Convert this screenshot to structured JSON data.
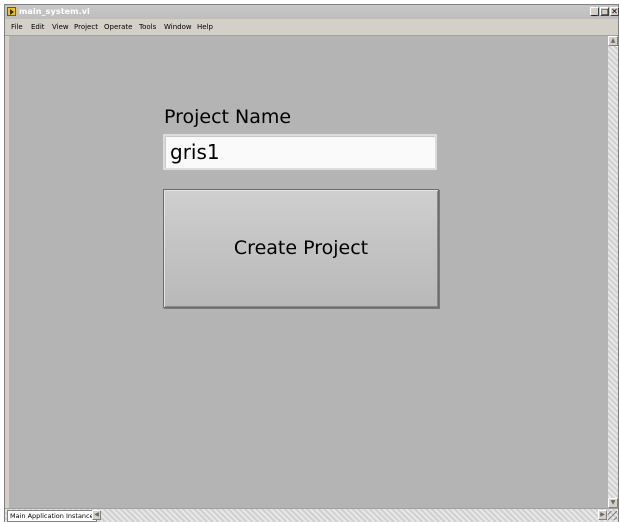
{
  "window": {
    "title": "main_system.vi",
    "minimize_glyph": "_",
    "maximize_glyph": "□",
    "close_glyph": "✕"
  },
  "menubar": {
    "items": [
      "File",
      "Edit",
      "View",
      "Project",
      "Operate",
      "Tools",
      "Window",
      "Help"
    ]
  },
  "panel": {
    "project_name_label": "Project Name",
    "project_name_value": "gris1",
    "create_button_label": "Create Project"
  },
  "statusbar": {
    "context": "Main Application Instance"
  },
  "icons": {
    "app": "labview-vi-icon",
    "scroll_up": "▲",
    "scroll_down": "▼",
    "scroll_left": "◀",
    "scroll_right": "▶"
  },
  "colors": {
    "panel_bg": "#b4b4b4",
    "button_face": "#c4c4c4",
    "input_bg": "#fafafa"
  }
}
